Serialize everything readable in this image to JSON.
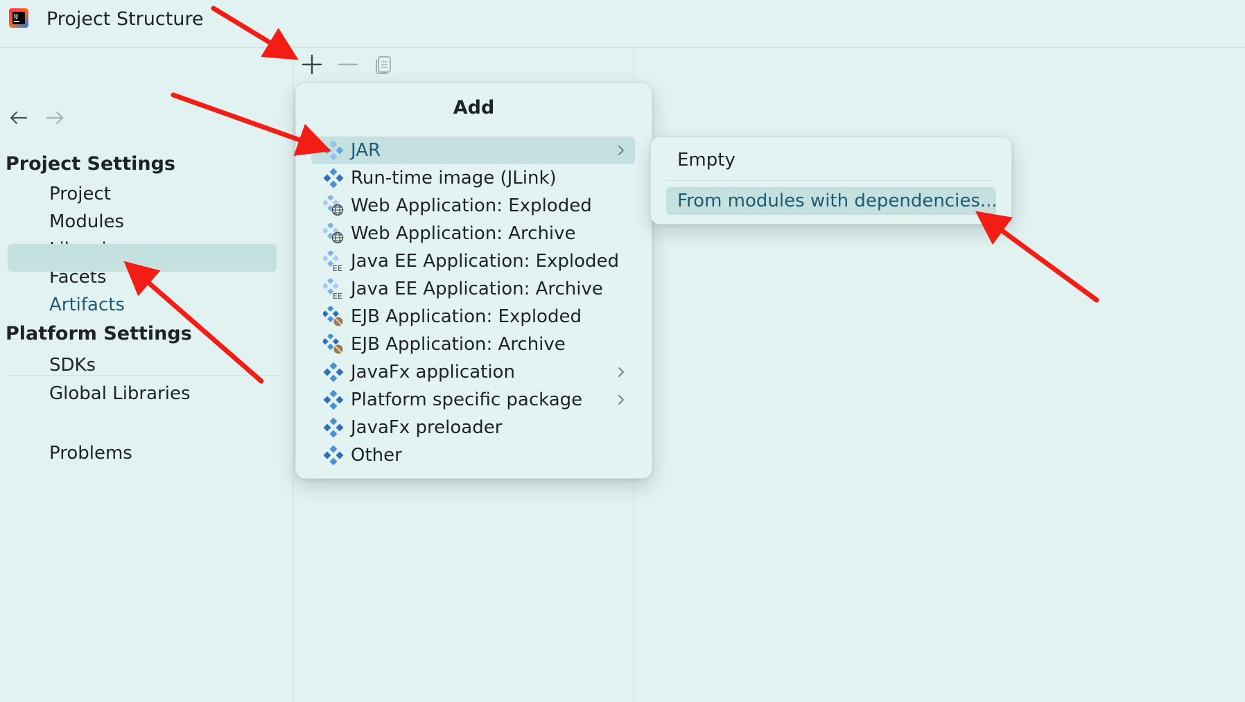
{
  "window": {
    "title": "Project Structure",
    "logo_icon": "intellij-logo-icon"
  },
  "navigation": {
    "back_icon": "arrow-left-icon",
    "forward_icon": "arrow-right-icon"
  },
  "sidebar": {
    "project_settings": {
      "header": "Project Settings",
      "items": [
        "Project",
        "Modules",
        "Libraries",
        "Facets",
        "Artifacts"
      ],
      "selected": "Artifacts"
    },
    "platform_settings": {
      "header": "Platform Settings",
      "items": [
        "SDKs",
        "Global Libraries"
      ]
    },
    "problems": "Problems"
  },
  "toolbar": {
    "add_icon": "plus-icon",
    "remove_icon": "minus-icon",
    "copy_icon": "copy-icon"
  },
  "add_menu": {
    "title": "Add",
    "items": [
      {
        "label": "JAR",
        "icon": "jar-icon",
        "submenu": true,
        "selected": true
      },
      {
        "label": "Run-time image (JLink)",
        "icon": "artifact-icon",
        "submenu": false
      },
      {
        "label": "Web Application: Exploded",
        "icon": "web-artifact-icon",
        "submenu": false
      },
      {
        "label": "Web Application: Archive",
        "icon": "web-artifact-icon",
        "submenu": false
      },
      {
        "label": "Java EE Application: Exploded",
        "icon": "javaee-artifact-icon",
        "submenu": false
      },
      {
        "label": "Java EE Application: Archive",
        "icon": "javaee-artifact-icon",
        "submenu": false
      },
      {
        "label": "EJB Application: Exploded",
        "icon": "ejb-artifact-icon",
        "submenu": false
      },
      {
        "label": "EJB Application: Archive",
        "icon": "ejb-artifact-icon",
        "submenu": false
      },
      {
        "label": "JavaFx application",
        "icon": "artifact-icon",
        "submenu": true
      },
      {
        "label": "Platform specific package",
        "icon": "artifact-icon",
        "submenu": true
      },
      {
        "label": "JavaFx preloader",
        "icon": "artifact-icon",
        "submenu": false
      },
      {
        "label": "Other",
        "icon": "artifact-icon",
        "submenu": false
      }
    ]
  },
  "jar_submenu": {
    "items": [
      "Empty",
      "From modules with dependencies..."
    ],
    "selected": "From modules with dependencies..."
  },
  "colors": {
    "background": "#e1f2f1",
    "selection": "#c5e1df",
    "selected_text": "#1f5b72",
    "annotation_arrow": "#f21d14",
    "icon_blue": "#4a8fd6"
  }
}
